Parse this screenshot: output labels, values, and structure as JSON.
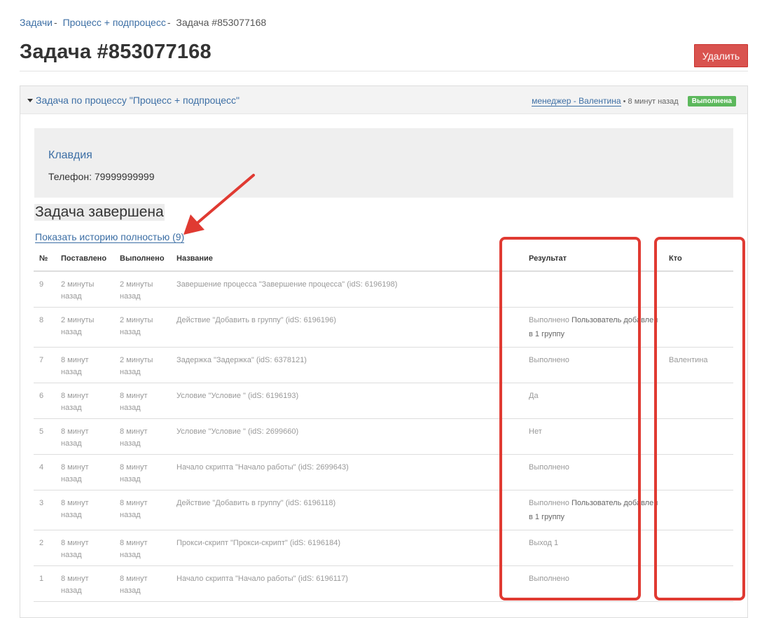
{
  "breadcrumb": {
    "items": [
      "Задачи",
      "Процесс + подпроцесс"
    ],
    "separator": "-",
    "current": "Задача #853077168"
  },
  "page": {
    "title": "Задача #853077168",
    "delete_label": "Удалить"
  },
  "panel": {
    "toggle_label": "Задача по процессу \"Процесс + подпроцесс\"",
    "manager_link": "менеджер - Валентина",
    "time_text": "• 8 минут назад",
    "status_badge": "Выполнена"
  },
  "client": {
    "name": "Клавдия",
    "phone": "Телефон: 79999999999"
  },
  "task_status": "Задача завершена",
  "history_link": "Показать историю полностью (9)",
  "table": {
    "headers": [
      "№",
      "Поставлено",
      "Выполнено",
      "Название",
      "Результат",
      "Кто"
    ],
    "rows": [
      {
        "n": "9",
        "set1": "2 минуты",
        "set2": "назад",
        "done1": "2 минуты",
        "done2": "назад",
        "name": "Завершение процесса \"Завершение процесса\" (idS: 6196198)",
        "result": "",
        "result_extra": "",
        "who": ""
      },
      {
        "n": "8",
        "set1": "2 минуты",
        "set2": "назад",
        "done1": "2 минуты",
        "done2": "назад",
        "name": "Действие \"Добавить в группу\" (idS: 6196196)",
        "result": "Выполнено",
        "result_extra": "Пользователь добавлен в 1 группу",
        "who": ""
      },
      {
        "n": "7",
        "set1": "8 минут",
        "set2": "назад",
        "done1": "2 минуты",
        "done2": "назад",
        "name": "Задержка \"Задержка\" (idS: 6378121)",
        "result": "Выполнено",
        "result_extra": "",
        "who": "Валентина"
      },
      {
        "n": "6",
        "set1": "8 минут",
        "set2": "назад",
        "done1": "8 минут",
        "done2": "назад",
        "name": "Условие \"Условие \" (idS: 6196193)",
        "result": "Да",
        "result_extra": "",
        "who": ""
      },
      {
        "n": "5",
        "set1": "8 минут",
        "set2": "назад",
        "done1": "8 минут",
        "done2": "назад",
        "name": "Условие \"Условие \" (idS: 2699660)",
        "result": "Нет",
        "result_extra": "",
        "who": ""
      },
      {
        "n": "4",
        "set1": "8 минут",
        "set2": "назад",
        "done1": "8 минут",
        "done2": "назад",
        "name": "Начало скрипта \"Начало работы\" (idS: 2699643)",
        "result": "Выполнено",
        "result_extra": "",
        "who": ""
      },
      {
        "n": "3",
        "set1": "8 минут",
        "set2": "назад",
        "done1": "8 минут",
        "done2": "назад",
        "name": "Действие \"Добавить в группу\" (idS: 6196118)",
        "result": "Выполнено",
        "result_extra": "Пользователь добавлен в 1 группу",
        "who": ""
      },
      {
        "n": "2",
        "set1": "8 минут",
        "set2": "назад",
        "done1": "8 минут",
        "done2": "назад",
        "name": "Прокси-скрипт \"Прокси-скрипт\" (idS: 6196184)",
        "result": "Выход 1",
        "result_extra": "",
        "who": ""
      },
      {
        "n": "1",
        "set1": "8 минут",
        "set2": "назад",
        "done1": "8 минут",
        "done2": "назад",
        "name": "Начало скрипта \"Начало работы\" (idS: 6196117)",
        "result": "Выполнено",
        "result_extra": "",
        "who": ""
      }
    ]
  },
  "colors": {
    "link": "#3d6fa5",
    "danger": "#d9534f",
    "success": "#5cb85c",
    "annotation": "#e03a32"
  }
}
